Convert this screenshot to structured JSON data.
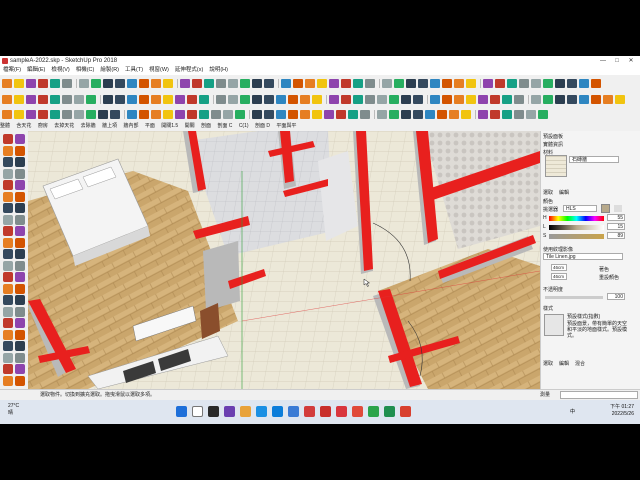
{
  "window": {
    "title": "sampleA-2022.skp - SketchUp Pro 2018",
    "minimize": "—",
    "maximize": "□",
    "close": "✕"
  },
  "menu": [
    "檔案(F)",
    "編輯(E)",
    "檢視(V)",
    "相機(C)",
    "繪製(R)",
    "工具(T)",
    "視窗(W)",
    "延伸程式(x)",
    "說明(H)"
  ],
  "context_bar": [
    "整體",
    "含天花",
    "廚房",
    "去掉天花",
    "去除牆",
    "牆上項",
    "牆內部",
    "平面",
    "開關1.5",
    "開關",
    "剖面",
    "剖面 C",
    "C(1)",
    "剖面 D",
    "平面與平"
  ],
  "tray": {
    "title": "預設面板",
    "section_entity": "實體資訊",
    "section_materials": "材料",
    "material_name": "石磚牆",
    "tab_select": "選取",
    "tab_edit": "編輯",
    "color_label": "顏色",
    "picker_label": "挑選器",
    "picker_mode": "HLS",
    "h_label": "H",
    "h_value": "55",
    "l_label": "L",
    "l_value": "15",
    "s_label": "S",
    "s_value": "89",
    "use_texture": "使用紋理影像",
    "texture_file": "Tile Linen.jpg",
    "size_w": "46cm",
    "size_h": "46cm",
    "colorize": "著色",
    "reset_color": "重設顏色",
    "opacity_label": "不透明度",
    "opacity_value": "100",
    "section_styles": "樣式",
    "style_name": "預設樣式(指數)",
    "style_desc": "預設面景，帶有簡單的天空和平淡的地面樣式。預設模式。",
    "style_tab_select": "選取",
    "style_tab_edit": "編輯",
    "style_tab_mix": "混合"
  },
  "status": {
    "left": "選取物件。切換到擴充選取。拖曳滑鼠以選取多項。",
    "measure_label": "測量"
  },
  "taskbar": {
    "temp": "27°C",
    "weather": "晴",
    "lang": "中",
    "time": "下午 01:27",
    "date": "2022/5/26"
  },
  "colors": {
    "wall_red": "#e8201e",
    "wood_floor": "#c9a670",
    "tile_floor": "#ece8d8"
  }
}
